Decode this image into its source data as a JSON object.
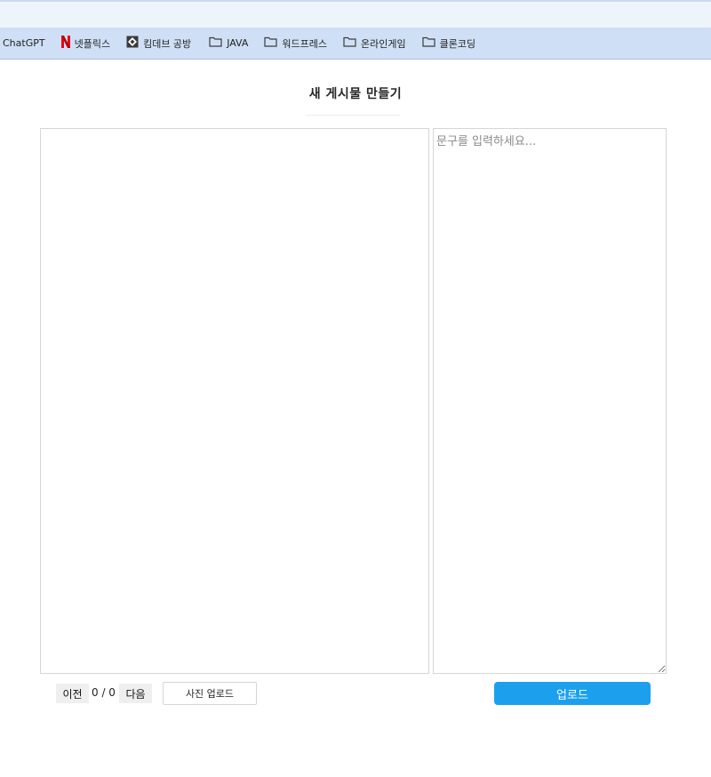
{
  "bookmarks_bar": {
    "items": [
      {
        "label": "ChatGPT",
        "icon": "none"
      },
      {
        "label": "넷플릭스",
        "icon": "netflix-logo-icon"
      },
      {
        "label": "킴데브 공방",
        "icon": "site-favicon-icon"
      },
      {
        "label": "JAVA",
        "icon": "folder-icon"
      },
      {
        "label": "워드프레스",
        "icon": "folder-icon"
      },
      {
        "label": "온라인게임",
        "icon": "folder-icon"
      },
      {
        "label": "클론코딩",
        "icon": "folder-icon"
      }
    ]
  },
  "page": {
    "title": "새 게시물 만들기"
  },
  "editor": {
    "caption_placeholder": "문구를 입력하세요...",
    "caption_value": "",
    "prev_label": "이전",
    "next_label": "다음",
    "counter": "0 / 0",
    "photo_upload_label": "사진 업로드",
    "upload_label": "업로드"
  },
  "colors": {
    "upload_button": "#1ca0ee",
    "bookmarks_bar": "#cfe0f6",
    "netflix_red": "#e50914"
  }
}
